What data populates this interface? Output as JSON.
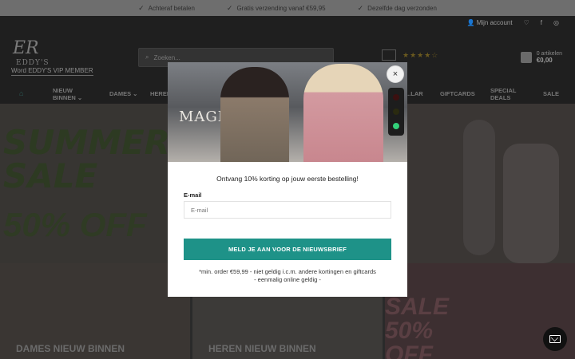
{
  "usp": [
    {
      "text": "Achteraf betalen"
    },
    {
      "text": "Gratis verzending vanaf €59,95"
    },
    {
      "text": "Dezelfde dag verzonden"
    }
  ],
  "header": {
    "account_label": "Mijn account",
    "vip_label": "Word EDDY'S VIP MEMBER",
    "logo_monogram": "ER",
    "logo_word": "EDDY'S",
    "search_placeholder": "Zoeken...",
    "rating_stars": "★★★★☆",
    "cart_label": "0 artikelen",
    "cart_amount": "€0,00"
  },
  "nav": [
    {
      "label": "NIEUW BINNEN ⌄"
    },
    {
      "label": "DAMES ⌄"
    },
    {
      "label": "HEREN ⌄"
    },
    {
      "label": "...LAR"
    },
    {
      "label": "GIFTCARDS"
    },
    {
      "label": "SPECIAL DEALS"
    },
    {
      "label": "SALE"
    }
  ],
  "hero": {
    "sale_text": "SUMMER SALE",
    "off_text": "50% OFF"
  },
  "tiles": [
    {
      "label": "DAMES NIEUW BINNEN"
    },
    {
      "label": "HEREN NIEUW BINNEN"
    },
    {
      "label": "SALE 50% OFF"
    }
  ],
  "modal": {
    "photo_sign": "MAGN   AZA",
    "title": "Ontvang 10% korting op jouw eerste bestelling!",
    "email_label": "E-mail",
    "email_placeholder": "E-mail",
    "submit_label": "MELD JE AAN VOOR DE NIEUWSBRIEF",
    "disclaimer_line1": "*min. order €59,99 - niet geldig i.c.m. andere kortingen en giftcards",
    "disclaimer_line2": "- eenmalig online geldig -",
    "close_glyph": "×"
  },
  "colors": {
    "accent": "#1e9288",
    "overlay": "#2a2a2a"
  }
}
